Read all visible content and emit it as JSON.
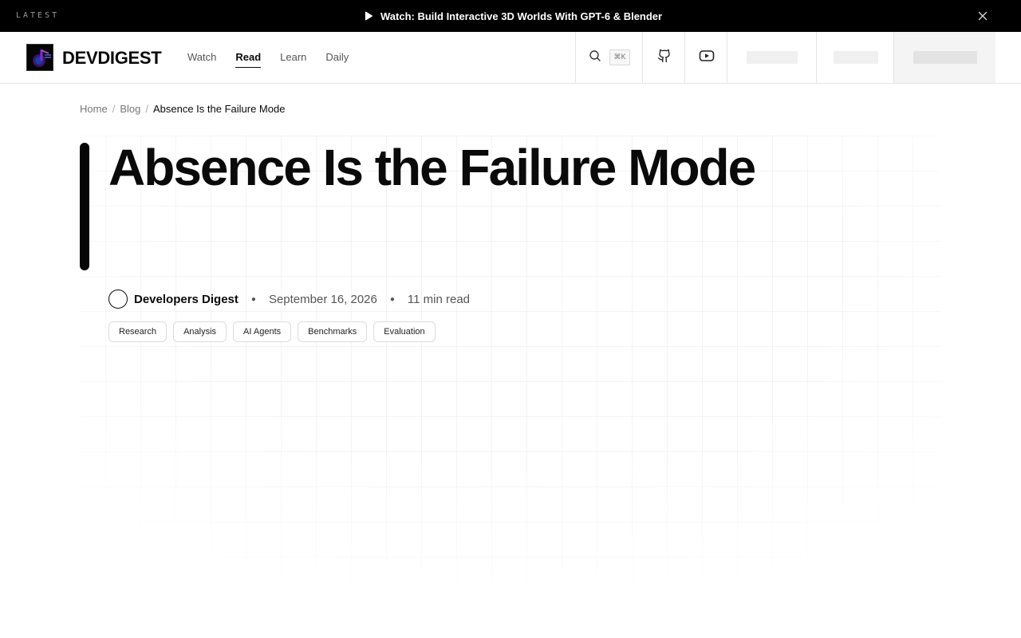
{
  "topbar": {
    "latest_label": "LATEST",
    "announcement": "Watch: Build Interactive 3D Worlds With GPT-6 & Blender",
    "announcement_icon": "play-icon",
    "close_icon": "close-icon"
  },
  "header": {
    "brand": "DEVDIGEST",
    "nav": [
      {
        "label": "Watch",
        "active": false
      },
      {
        "label": "Read",
        "active": true
      },
      {
        "label": "Learn",
        "active": false
      },
      {
        "label": "Daily",
        "active": false
      }
    ],
    "search_icon": "search-icon",
    "search_shortcut": "⌘K",
    "github_icon": "github-icon",
    "youtube_icon": "youtube-icon"
  },
  "breadcrumb": {
    "items": [
      "Home",
      "Blog"
    ],
    "current": "Absence Is the Failure Mode"
  },
  "article": {
    "title": "Absence Is the Failure Mode",
    "author": "Developers Digest",
    "date": "September 16, 2026",
    "read_time": "11 min read",
    "tags": [
      "Research",
      "Analysis",
      "AI Agents",
      "Benchmarks",
      "Evaluation"
    ]
  },
  "colors": {
    "topbar_bg": "#000000",
    "accent": "#0a0a0a",
    "border": "#e5e5e5"
  }
}
